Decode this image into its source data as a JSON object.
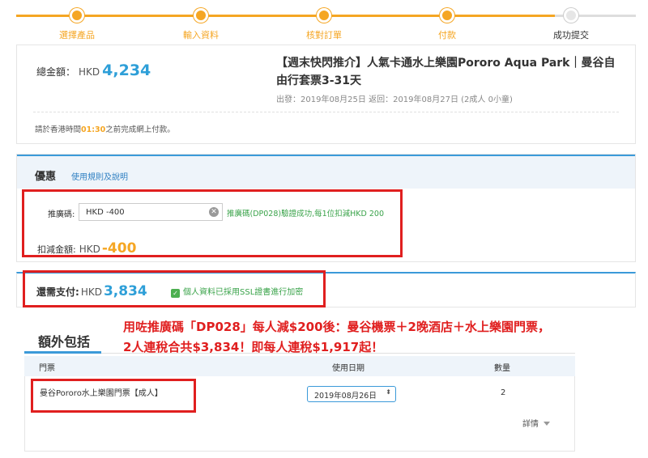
{
  "stepper": {
    "steps": [
      {
        "label": "選擇產品",
        "done": true
      },
      {
        "label": "輸入資料",
        "done": true
      },
      {
        "label": "核對訂單",
        "done": true
      },
      {
        "label": "付款",
        "done": true
      },
      {
        "label": "成功提交",
        "done": false
      }
    ]
  },
  "summary": {
    "total_label": "總金額：",
    "currency": "HKD",
    "total_amount": "4,234",
    "product_title": "【週末快閃推介】人氣卡通水上樂園Pororo Aqua Park｜曼谷自由行套票3-31天",
    "dates": "出發：2019年08月25日 返回：2019年08月27日 (2成人 0小童)",
    "deadline_prefix": "請於香港時間",
    "deadline_time": "01:30",
    "deadline_suffix": "之前完成網上付款。"
  },
  "discount": {
    "title": "優惠",
    "rules_link": "使用規則及說明",
    "promo_label": "推廣碼:",
    "promo_value": "HKD -400",
    "promo_message": "推廣碼(DP028)驗證成功,每1位扣減HKD 200",
    "deduct_label": "扣減金額:",
    "deduct_currency": "HKD",
    "deduct_amount": "-400"
  },
  "pay": {
    "label": "還需支付:",
    "currency": "HKD",
    "amount": "3,834",
    "ssl_text": "個人資料已採用SSL證書進行加密"
  },
  "annotation": {
    "line1": "用咗推廣碼「DP028」每人減$200後：曼谷機票＋2晚酒店＋水上樂園門票，",
    "line2": "2人連稅合共$3,834！即每人連稅$1,917起！"
  },
  "extras": {
    "title": "額外包括",
    "headers": {
      "ticket": "門票",
      "date": "使用日期",
      "qty": "數量"
    },
    "row": {
      "name": "曼谷Pororo水上樂園門票【成人】",
      "date": "2019年08月26日",
      "qty": "2",
      "details": "詳情"
    }
  },
  "colors": {
    "accent_orange": "#f5a623",
    "accent_blue": "#2e9fd8",
    "highlight_red": "#e01f1f",
    "success_green": "#3aa34a"
  }
}
